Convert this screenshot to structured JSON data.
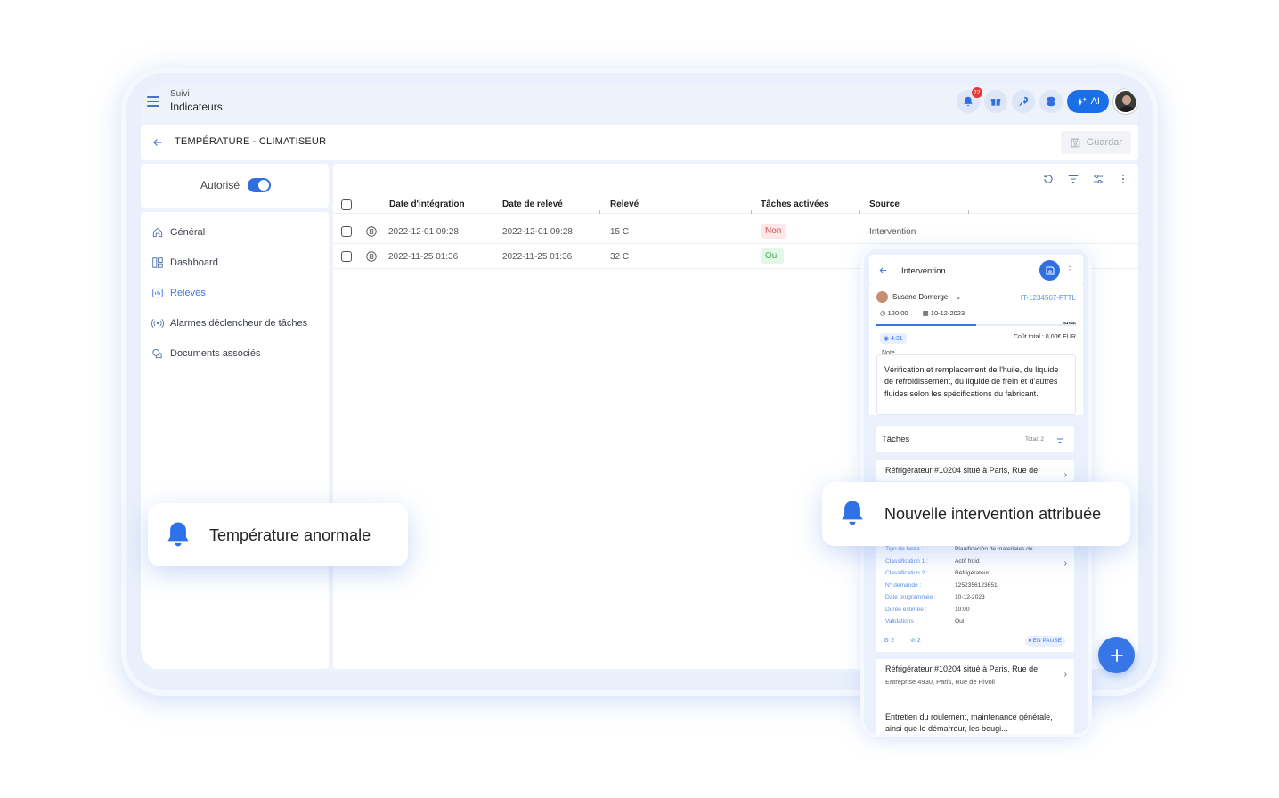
{
  "header": {
    "crumb_parent": "Suivi",
    "crumb_current": "Indicateurs",
    "notif_count": "22",
    "ai_label": "AI"
  },
  "titlebar": {
    "title": "TEMPÉRATURE - CLIMATISEUR",
    "save_label": "Guardar"
  },
  "auth": {
    "label": "Autorisé",
    "enabled": true
  },
  "nav": {
    "items": [
      {
        "label": "Général",
        "icon": "home-icon"
      },
      {
        "label": "Dashboard",
        "icon": "dashboard-icon"
      },
      {
        "label": "Relevés",
        "icon": "readings-icon",
        "active": true
      },
      {
        "label": "Alarmes déclencheur de tâches",
        "icon": "alarm-icon"
      },
      {
        "label": "Documents associés",
        "icon": "documents-icon"
      }
    ]
  },
  "table": {
    "columns": [
      "Date d'intégration",
      "Date de relevé",
      "Relevé",
      "Tâches activées",
      "Source"
    ],
    "rows": [
      {
        "integration": "2022-12-01 09:28",
        "releve_date": "2022-12-01 09:28",
        "releve": "15 C",
        "taches": "Non",
        "source": "Intervention"
      },
      {
        "integration": "2022-11-25 01:36",
        "releve_date": "2022-11-25 01:36",
        "releve": "32 C",
        "taches": "Oui",
        "source": ""
      }
    ]
  },
  "phone": {
    "title": "Intervention",
    "user": "Susane Domerge",
    "ref": "IT-1234567-FTTL",
    "duration": "120:00",
    "date": "10-12-2023",
    "progress_pct": "50%",
    "progress": 0.5,
    "timer": "4:31",
    "cost": "Coût total : 0,00€ EUR",
    "note_label": "Note",
    "note": "Vérification et remplacement de l'huile, du liquide de refroidissement, du liquide de frein et d'autres fluides selon les spécifications du fabricant.",
    "tasks_label": "Tâches",
    "tasks_total": "Total: 2",
    "task1_title": "Réfrigérateur #10204 situé à Paris, Rue de",
    "details": [
      {
        "k": "Tipo de tarea :",
        "v": "Planificación de materiales de"
      },
      {
        "k": "Classification 1 :",
        "v": "Actif froid"
      },
      {
        "k": "Classification 2 :",
        "v": "Réfrigérateur"
      },
      {
        "k": "N° demande :",
        "v": "1252356123651"
      },
      {
        "k": "Date programmée :",
        "v": "10-12-2023"
      },
      {
        "k": "Durée estimée :",
        "v": "10:00"
      },
      {
        "k": "Validations :",
        "v": "Oui"
      }
    ],
    "foot_a": "2",
    "foot_b": "2",
    "status": "EN PAUSE",
    "task2_title": "Réfrigérateur #10204 situé à Paris, Rue de",
    "task2_sub": "Entreprise 4930, Paris, Rue de Rivoli",
    "task2_desc": "Entretien du roulement, maintenance générale, ainsi que le démarreur, les bougi..."
  },
  "toasts": {
    "left": "Température anormale",
    "right": "Nouvelle intervention attribuée"
  },
  "colors": {
    "accent": "#3676e6",
    "danger": "#d94c4c",
    "success": "#3fae55"
  }
}
